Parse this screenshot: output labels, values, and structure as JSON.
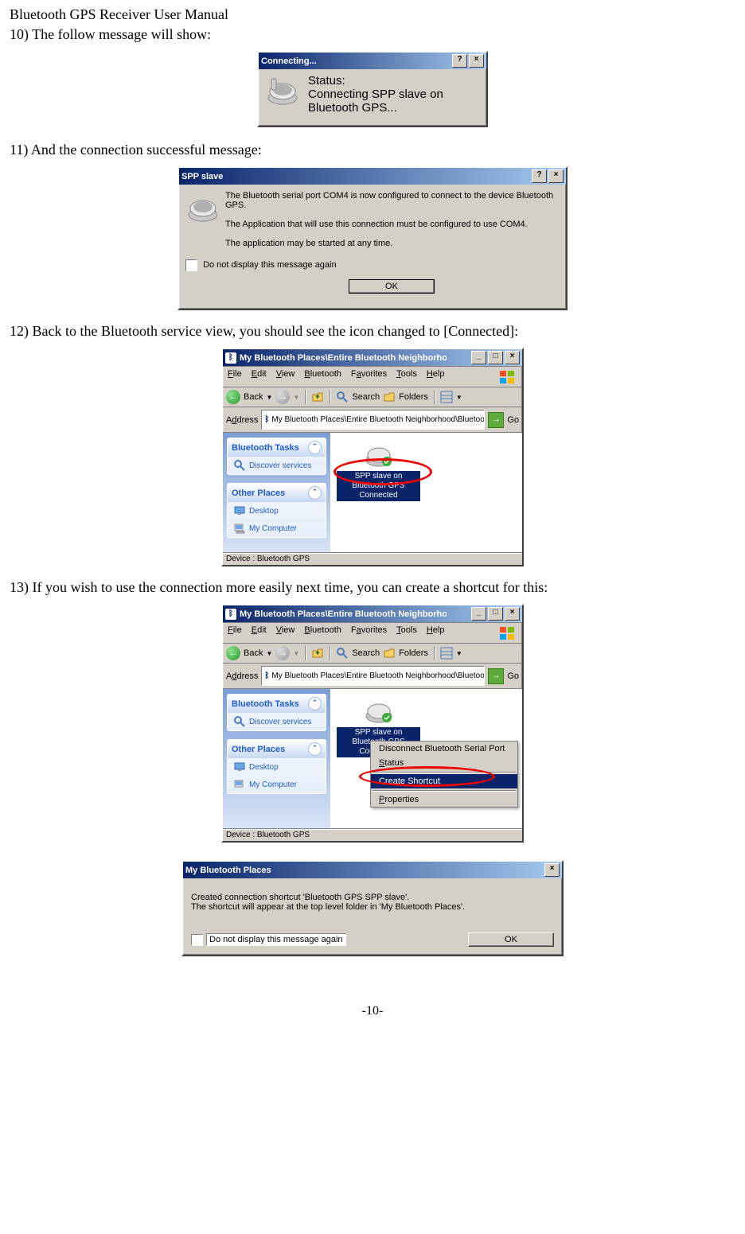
{
  "doc": {
    "title": "Bluetooth GPS Receiver User Manual",
    "pagenum": "-10-"
  },
  "steps": {
    "s10": "10) The follow message will show:",
    "s11": "11) And the connection successful message:",
    "s12": "12) Back to the Bluetooth service view, you should see the icon changed to [Connected]:",
    "s13": "13) If you wish to use the connection more easily next time, you can create a shortcut for this:"
  },
  "dlg1": {
    "title": "Connecting...",
    "status_lbl": "Status:",
    "status_1": "Connecting SPP slave on",
    "status_2": "Bluetooth GPS..."
  },
  "dlg2": {
    "title": "SPP slave",
    "line1": "The Bluetooth serial port COM4 is now configured to connect to the device Bluetooth GPS.",
    "line2": "The Application that will use this connection must be configured to use COM4.",
    "line3": "The application may be started at any time.",
    "dont": "Do not display this message again",
    "ok": "OK"
  },
  "explorer": {
    "title": "My Bluetooth Places\\Entire Bluetooth Neighborhood\\Bluetooth GPS",
    "menus": {
      "file": "File",
      "edit": "Edit",
      "view": "View",
      "bt": "Bluetooth",
      "fav": "Favorites",
      "tools": "Tools",
      "help": "Help"
    },
    "toolbar": {
      "back": "Back",
      "search": "Search",
      "folders": "Folders"
    },
    "addr_lbl": "Address",
    "addr_val": "My Bluetooth Places\\Entire Bluetooth Neighborhood\\Bluetooth GPS",
    "go": "Go",
    "tasks_h": "Bluetooth Tasks",
    "tasks_1": "Discover services",
    "other_h": "Other Places",
    "other_1": "Desktop",
    "other_2": "My Computer",
    "item_l1": "SPP slave on Bluetooth GPS",
    "item_l2": "Connected",
    "status": "Device : Bluetooth GPS"
  },
  "ctx": {
    "i1": "Disconnect Bluetooth Serial Port",
    "i2": "Status",
    "i3": "Create Shortcut",
    "i4": "Properties"
  },
  "dlg5": {
    "title": "My Bluetooth Places",
    "line1": "Created connection shortcut 'Bluetooth GPS SPP slave'.",
    "line2": "The shortcut will appear at the top level folder in 'My Bluetooth Places'.",
    "dont": "Do not display this message again",
    "ok": "OK"
  }
}
